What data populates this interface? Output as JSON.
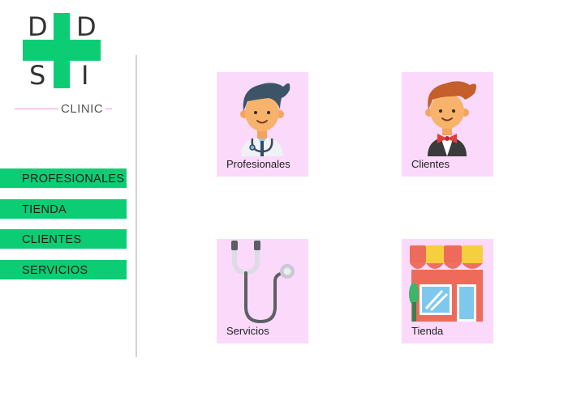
{
  "brand": {
    "letters": [
      "D",
      "D",
      "S",
      "I"
    ],
    "word": "CLINIC",
    "colors": {
      "cross": "#0ccd73",
      "line": "#f298d8",
      "text": "#333333"
    }
  },
  "nav": {
    "items": [
      {
        "label": "PROFESIONALES"
      },
      {
        "label": "TIENDA"
      },
      {
        "label": "CLIENTES"
      },
      {
        "label": "SERVICIOS"
      }
    ],
    "color": "#0ccd73"
  },
  "cards": [
    {
      "label": "Profesionales",
      "icon": "doctor-icon"
    },
    {
      "label": "Clientes",
      "icon": "client-icon"
    },
    {
      "label": "Servicios",
      "icon": "stethoscope-icon"
    },
    {
      "label": "Tienda",
      "icon": "store-icon"
    }
  ],
  "colors": {
    "card_bg": "#fbd9fb"
  }
}
